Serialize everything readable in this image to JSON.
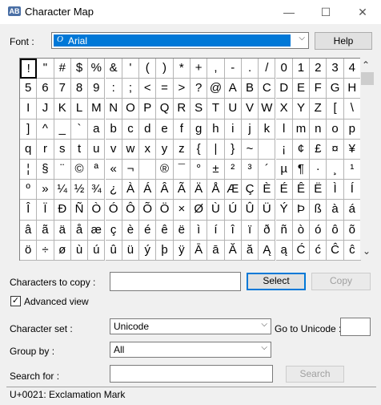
{
  "window": {
    "title": "Character Map",
    "icon_label": "AB",
    "minimize": "—",
    "maximize": "☐",
    "close": "✕"
  },
  "font_row": {
    "label": "Font :",
    "value": "Arial",
    "font_icon": "O",
    "help_label": "Help"
  },
  "grid": {
    "columns": 20,
    "rows": 10,
    "selected": "!",
    "chars": [
      "!",
      "\"",
      "#",
      "$",
      "%",
      "&",
      "'",
      "(",
      ")",
      "*",
      "+",
      ",",
      "-",
      ".",
      "/",
      "0",
      "1",
      "2",
      "3",
      "4",
      "5",
      "6",
      "7",
      "8",
      "9",
      ":",
      ";",
      "<",
      "=",
      ">",
      "?",
      "@",
      "A",
      "B",
      "C",
      "D",
      "E",
      "F",
      "G",
      "H",
      "I",
      "J",
      "K",
      "L",
      "M",
      "N",
      "O",
      "P",
      "Q",
      "R",
      "S",
      "T",
      "U",
      "V",
      "W",
      "X",
      "Y",
      "Z",
      "[",
      "\\",
      "]",
      "^",
      "_",
      "`",
      "a",
      "b",
      "c",
      "d",
      "e",
      "f",
      "g",
      "h",
      "i",
      "j",
      "k",
      "l",
      "m",
      "n",
      "o",
      "p",
      "q",
      "r",
      "s",
      "t",
      "u",
      "v",
      "w",
      "x",
      "y",
      "z",
      "{",
      "|",
      "}",
      "~",
      " ",
      "¡",
      "¢",
      "£",
      "¤",
      "¥",
      "¦",
      "§",
      "¨",
      "©",
      "ª",
      "«",
      "¬",
      "­",
      "®",
      "¯",
      "°",
      "±",
      "²",
      "³",
      "´",
      "µ",
      "¶",
      "·",
      "¸",
      "¹",
      "º",
      "»",
      "¼",
      "½",
      "¾",
      "¿",
      "À",
      "Á",
      "Â",
      "Ã",
      "Ä",
      "Å",
      "Æ",
      "Ç",
      "È",
      "É",
      "Ê",
      "Ë",
      "Ì",
      "Í",
      "Î",
      "Ï",
      "Ð",
      "Ñ",
      "Ò",
      "Ó",
      "Ô",
      "Õ",
      "Ö",
      "×",
      "Ø",
      "Ù",
      "Ú",
      "Û",
      "Ü",
      "Ý",
      "Þ",
      "ß",
      "à",
      "á",
      "â",
      "ã",
      "ä",
      "å",
      "æ",
      "ç",
      "è",
      "é",
      "ê",
      "ë",
      "ì",
      "í",
      "î",
      "ï",
      "ð",
      "ñ",
      "ò",
      "ó",
      "ô",
      "õ",
      "ö",
      "÷",
      "ø",
      "ù",
      "ú",
      "û",
      "ü",
      "ý",
      "þ",
      "ÿ",
      "Ā",
      "ā",
      "Ă",
      "ă",
      "Ą",
      "ą",
      "Ć",
      "ć",
      "Ĉ",
      "ĉ"
    ]
  },
  "scrollbar": {
    "up": "⌃",
    "down": "⌄"
  },
  "copy_row": {
    "label": "Characters to copy :",
    "value": "",
    "select_label": "Select",
    "copy_label": "Copy"
  },
  "advanced": {
    "label": "Advanced view",
    "checked": "✓"
  },
  "charset": {
    "label": "Character set :",
    "value": "Unicode",
    "goto_label": "Go to Unicode :",
    "goto_value": ""
  },
  "groupby": {
    "label": "Group by :",
    "value": "All"
  },
  "search": {
    "label": "Search for :",
    "value": "",
    "button_label": "Search"
  },
  "status": {
    "text": "U+0021: Exclamation Mark"
  }
}
